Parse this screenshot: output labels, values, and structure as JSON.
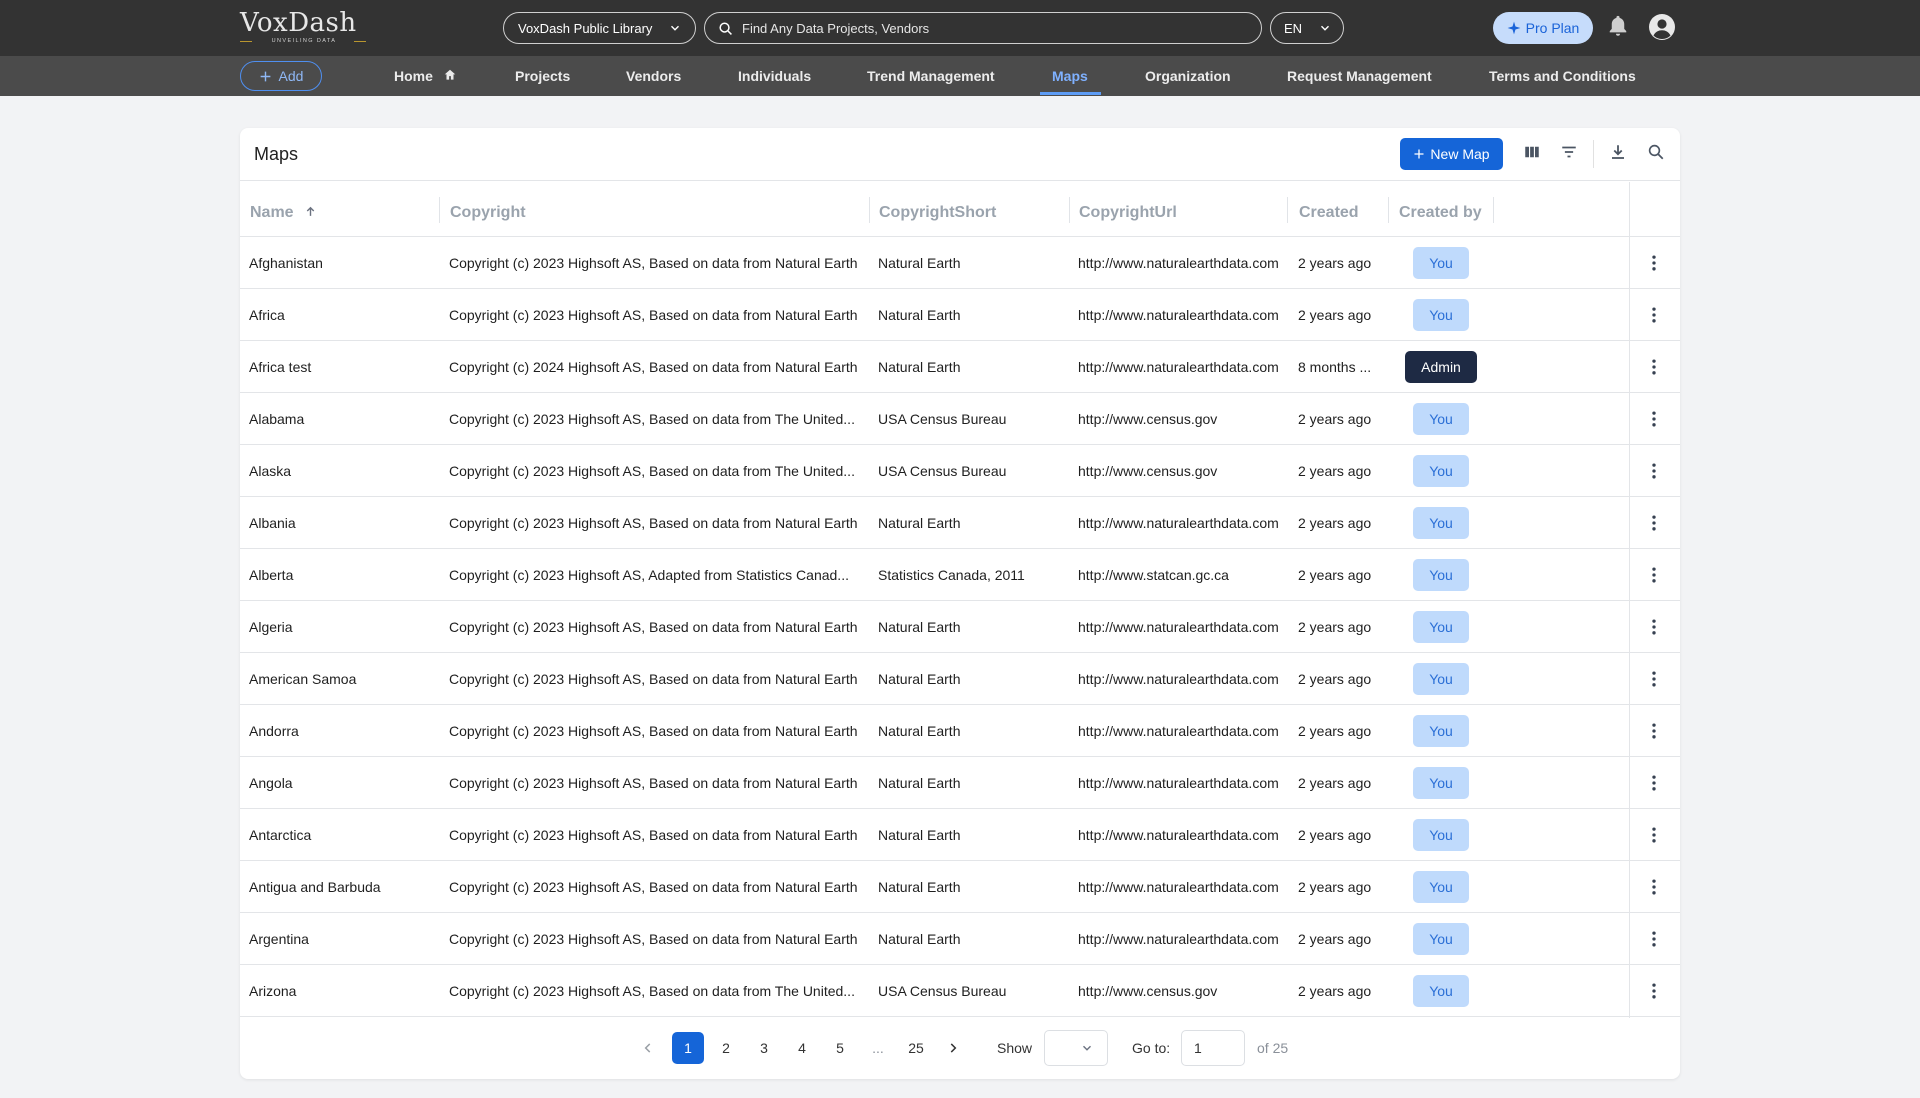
{
  "header": {
    "logo_text": "VoxDash",
    "logo_tagline": "UNVEILING DATA",
    "library_select": "VoxDash Public Library",
    "search_placeholder": "Find Any Data Projects, Vendors",
    "language": "EN",
    "pro_plan_label": "Pro Plan"
  },
  "nav": {
    "add_label": "Add",
    "items": [
      {
        "label": "Home"
      },
      {
        "label": "Projects"
      },
      {
        "label": "Vendors"
      },
      {
        "label": "Individuals"
      },
      {
        "label": "Trend Management"
      },
      {
        "label": "Maps"
      },
      {
        "label": "Organization"
      },
      {
        "label": "Request Management"
      },
      {
        "label": "Terms and Conditions"
      }
    ],
    "active": "Maps"
  },
  "page": {
    "title": "Maps",
    "new_map_label": "New Map"
  },
  "table": {
    "columns": [
      "Name",
      "Copyright",
      "CopyrightShort",
      "CopyrightUrl",
      "Created",
      "Created by"
    ],
    "sort_column": "Name",
    "sort_direction": "ascending",
    "rows": [
      {
        "name": "Afghanistan",
        "copyright": "Copyright (c) 2023 Highsoft AS, Based on data from Natural Earth",
        "short": "Natural Earth",
        "url": "http://www.naturalearthdata.com",
        "created": "2 years ago",
        "created_by": "You"
      },
      {
        "name": "Africa",
        "copyright": "Copyright (c) 2023 Highsoft AS, Based on data from Natural Earth",
        "short": "Natural Earth",
        "url": "http://www.naturalearthdata.com",
        "created": "2 years ago",
        "created_by": "You"
      },
      {
        "name": "Africa test",
        "copyright": "Copyright (c) 2024 Highsoft AS, Based on data from Natural Earth",
        "short": "Natural Earth",
        "url": "http://www.naturalearthdata.com",
        "created": "8 months ...",
        "created_by": "Admin"
      },
      {
        "name": "Alabama",
        "copyright": "Copyright (c) 2023 Highsoft AS, Based on data from The United...",
        "short": "USA Census Bureau",
        "url": "http://www.census.gov",
        "created": "2 years ago",
        "created_by": "You"
      },
      {
        "name": "Alaska",
        "copyright": "Copyright (c) 2023 Highsoft AS, Based on data from The United...",
        "short": "USA Census Bureau",
        "url": "http://www.census.gov",
        "created": "2 years ago",
        "created_by": "You"
      },
      {
        "name": "Albania",
        "copyright": "Copyright (c) 2023 Highsoft AS, Based on data from Natural Earth",
        "short": "Natural Earth",
        "url": "http://www.naturalearthdata.com",
        "created": "2 years ago",
        "created_by": "You"
      },
      {
        "name": "Alberta",
        "copyright": "Copyright (c) 2023 Highsoft AS, Adapted from Statistics Canad...",
        "short": "Statistics Canada, 2011",
        "url": "http://www.statcan.gc.ca",
        "created": "2 years ago",
        "created_by": "You"
      },
      {
        "name": "Algeria",
        "copyright": "Copyright (c) 2023 Highsoft AS, Based on data from Natural Earth",
        "short": "Natural Earth",
        "url": "http://www.naturalearthdata.com",
        "created": "2 years ago",
        "created_by": "You"
      },
      {
        "name": "American Samoa",
        "copyright": "Copyright (c) 2023 Highsoft AS, Based on data from Natural Earth",
        "short": "Natural Earth",
        "url": "http://www.naturalearthdata.com",
        "created": "2 years ago",
        "created_by": "You"
      },
      {
        "name": "Andorra",
        "copyright": "Copyright (c) 2023 Highsoft AS, Based on data from Natural Earth",
        "short": "Natural Earth",
        "url": "http://www.naturalearthdata.com",
        "created": "2 years ago",
        "created_by": "You"
      },
      {
        "name": "Angola",
        "copyright": "Copyright (c) 2023 Highsoft AS, Based on data from Natural Earth",
        "short": "Natural Earth",
        "url": "http://www.naturalearthdata.com",
        "created": "2 years ago",
        "created_by": "You"
      },
      {
        "name": "Antarctica",
        "copyright": "Copyright (c) 2023 Highsoft AS, Based on data from Natural Earth",
        "short": "Natural Earth",
        "url": "http://www.naturalearthdata.com",
        "created": "2 years ago",
        "created_by": "You"
      },
      {
        "name": "Antigua and Barbuda",
        "copyright": "Copyright (c) 2023 Highsoft AS, Based on data from Natural Earth",
        "short": "Natural Earth",
        "url": "http://www.naturalearthdata.com",
        "created": "2 years ago",
        "created_by": "You"
      },
      {
        "name": "Argentina",
        "copyright": "Copyright (c) 2023 Highsoft AS, Based on data from Natural Earth",
        "short": "Natural Earth",
        "url": "http://www.naturalearthdata.com",
        "created": "2 years ago",
        "created_by": "You"
      },
      {
        "name": "Arizona",
        "copyright": "Copyright (c) 2023 Highsoft AS, Based on data from The United...",
        "short": "USA Census Bureau",
        "url": "http://www.census.gov",
        "created": "2 years ago",
        "created_by": "You"
      }
    ]
  },
  "pagination": {
    "pages": [
      "1",
      "2",
      "3",
      "4",
      "5",
      "...",
      "25"
    ],
    "current_page": "1",
    "show_label": "Show",
    "show_value": "",
    "goto_label": "Go to:",
    "goto_value": "1",
    "of_label": "of 25"
  },
  "icons": {
    "search": "search-icon",
    "chevron": "chevron-down-icon",
    "sparkle": "sparkle-icon",
    "bell": "bell-icon",
    "avatar": "user-avatar-icon",
    "plus": "plus-icon",
    "home": "home-icon",
    "columns": "columns-icon",
    "filter": "filter-icon",
    "download": "download-icon",
    "more": "more-vertical-icon",
    "sort": "arrow-up-icon",
    "prev": "chevron-left-icon",
    "next": "chevron-right-icon"
  },
  "colors": {
    "topbar": "#333333",
    "navbar": "#4b4b4b",
    "accent": "#1565d8",
    "active_nav": "#7fb1ff",
    "badge_you_bg": "#bfdafc",
    "badge_admin_bg": "#1e2a44"
  }
}
